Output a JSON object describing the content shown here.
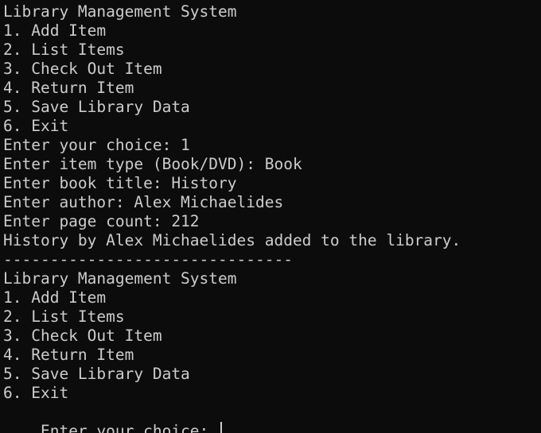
{
  "terminal": {
    "lines": [
      "Library Management System",
      "1. Add Item",
      "2. List Items",
      "3. Check Out Item",
      "4. Return Item",
      "5. Save Library Data",
      "6. Exit",
      "Enter your choice: 1",
      "Enter item type (Book/DVD): Book",
      "Enter book title: History",
      "Enter author: Alex Michaelides",
      "Enter page count: 212",
      "History by Alex Michaelides added to the library.",
      "-------------------------------",
      "Library Management System",
      "1. Add Item",
      "2. List Items",
      "3. Check Out Item",
      "4. Return Item",
      "5. Save Library Data",
      "6. Exit"
    ],
    "prompt": "Enter your choice: ",
    "colors": {
      "background": "#0c0c0c",
      "foreground": "#cccccc"
    }
  }
}
